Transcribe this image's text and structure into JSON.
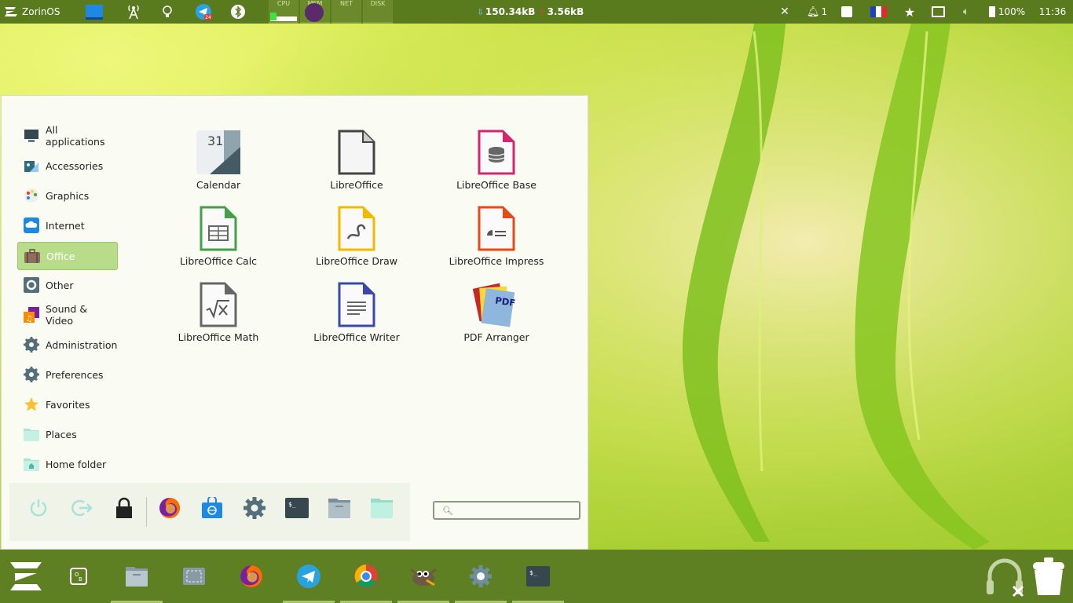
{
  "top_panel": {
    "os_label": "ZorinOS",
    "graph_labels": {
      "cpu": "CPU",
      "mem": "MEM",
      "net": "NET",
      "disk": "DISK"
    },
    "net_down": "150.34kB",
    "net_up": "3.56kB",
    "notification_count": "1",
    "battery": "100%",
    "clock": "11:36",
    "icons": [
      "display-icon",
      "signal-tower-icon",
      "bulb-icon",
      "telegram-icon",
      "bluetooth-icon",
      "close-icon",
      "bell-icon",
      "keyboard-icon",
      "france-flag-icon",
      "star-icon",
      "screen-icon",
      "volume-icon",
      "battery-icon"
    ]
  },
  "menu": {
    "categories": [
      {
        "label": "All applications",
        "icon": "monitor-icon"
      },
      {
        "label": "Accessories",
        "icon": "accessories-icon"
      },
      {
        "label": "Graphics",
        "icon": "palette-icon"
      },
      {
        "label": "Internet",
        "icon": "cloud-icon"
      },
      {
        "label": "Office",
        "icon": "briefcase-icon",
        "active": true
      },
      {
        "label": "Other",
        "icon": "gear-icon"
      },
      {
        "label": "Sound & Video",
        "icon": "music-icon"
      },
      {
        "label": "Administration",
        "icon": "gear-icon"
      },
      {
        "label": "Preferences",
        "icon": "gear-icon"
      },
      {
        "label": "Favorites",
        "icon": "star-icon"
      },
      {
        "label": "Places",
        "icon": "folder-icon"
      },
      {
        "label": "Home folder",
        "icon": "home-folder-icon"
      }
    ],
    "apps": [
      {
        "label": "Calendar",
        "icon": "calendar-icon",
        "day": "31"
      },
      {
        "label": "LibreOffice",
        "icon": "libreoffice-icon"
      },
      {
        "label": "LibreOffice Base",
        "icon": "libreoffice-base-icon"
      },
      {
        "label": "LibreOffice Calc",
        "icon": "libreoffice-calc-icon"
      },
      {
        "label": "LibreOffice Draw",
        "icon": "libreoffice-draw-icon"
      },
      {
        "label": "LibreOffice Impress",
        "icon": "libreoffice-impress-icon"
      },
      {
        "label": "LibreOffice Math",
        "icon": "libreoffice-math-icon"
      },
      {
        "label": "LibreOffice Writer",
        "icon": "libreoffice-writer-icon"
      },
      {
        "label": "PDF Arranger",
        "icon": "pdf-arranger-icon",
        "badge": "PDF"
      }
    ],
    "search": {
      "placeholder": "",
      "value": ""
    },
    "colors": {
      "active_category": "#b9dc8a",
      "base": "#d6246e",
      "calc": "#43a047",
      "draw": "#f5b800",
      "impress": "#e64a19",
      "writer": "#3949ab",
      "math": "#666666"
    }
  },
  "taskbar": {
    "items": [
      "zorin-menu-icon",
      "onboard-icon",
      "files-icon",
      "screenshot-icon",
      "firefox-icon",
      "telegram-icon",
      "chrome-icon",
      "gimp-icon",
      "settings-icon",
      "terminal-icon",
      "headphones-icon",
      "trash-icon"
    ]
  }
}
